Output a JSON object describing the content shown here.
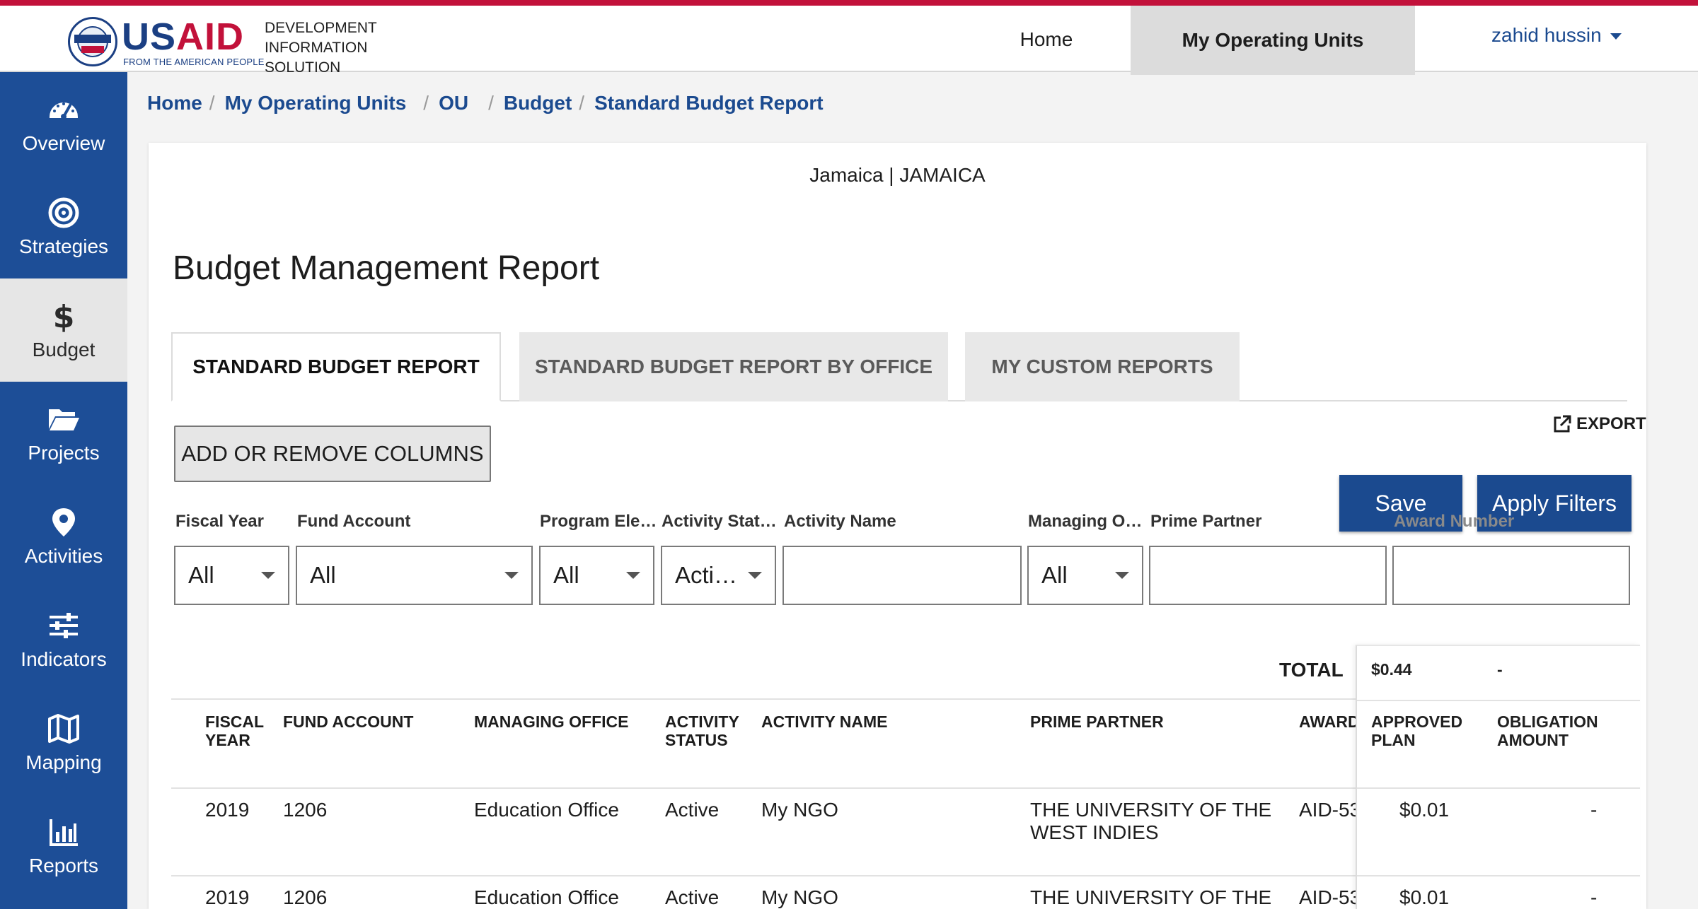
{
  "header": {
    "logo_text_usa": "US",
    "logo_text_aid": "AID",
    "logo_tagline": "FROM THE AMERICAN PEOPLE",
    "app_name_lines": [
      "DEVELOPMENT",
      "INFORMATION",
      "SOLUTION"
    ],
    "nav": {
      "home": "Home",
      "operating_units": "My Operating Units"
    },
    "user_name": "zahid hussin"
  },
  "sidebar": {
    "items": [
      {
        "label": "Overview",
        "icon": "dashboard-icon"
      },
      {
        "label": "Strategies",
        "icon": "target-icon"
      },
      {
        "label": "Budget",
        "icon": "dollar-icon",
        "active": true
      },
      {
        "label": "Projects",
        "icon": "folder-icon"
      },
      {
        "label": "Activities",
        "icon": "map-pin-icon"
      },
      {
        "label": "Indicators",
        "icon": "sliders-icon"
      },
      {
        "label": "Mapping",
        "icon": "map-icon"
      },
      {
        "label": "Reports",
        "icon": "bar-chart-icon"
      }
    ]
  },
  "breadcrumb": [
    "Home",
    "My Operating Units",
    "OU",
    "Budget",
    "Standard Budget Report"
  ],
  "main": {
    "ou_name": "Jamaica | JAMAICA",
    "title": "Budget Management Report",
    "tabs": [
      {
        "label": "STANDARD BUDGET REPORT",
        "active": true
      },
      {
        "label": "STANDARD BUDGET REPORT BY OFFICE",
        "active": false
      },
      {
        "label": "MY CUSTOM REPORTS",
        "active": false
      }
    ],
    "export_label": "EXPORT",
    "columns_button": "ADD OR REMOVE COLUMNS",
    "save_button": "Save",
    "apply_button": "Apply Filters",
    "filters": {
      "fiscal_year": {
        "label": "Fiscal Year",
        "value": "All"
      },
      "fund_account": {
        "label": "Fund Account",
        "value": "All"
      },
      "program_element": {
        "label": "Program Ele…",
        "value": "All"
      },
      "activity_status": {
        "label": "Activity Stat…",
        "value": "Activ…"
      },
      "activity_name": {
        "label": "Activity Name",
        "value": ""
      },
      "managing_office": {
        "label": "Managing O…",
        "value": "All"
      },
      "prime_partner": {
        "label": "Prime Partner",
        "value": ""
      },
      "award_number": {
        "label": "Award Number",
        "value": ""
      }
    }
  },
  "table": {
    "total_label": "TOTAL",
    "total_approved_plan": "$0.44",
    "total_obligation": "-",
    "headers": {
      "fiscal_year": [
        "FISCAL",
        "YEAR"
      ],
      "fund_account": "FUND ACCOUNT",
      "managing_office": "MANAGING OFFICE",
      "activity_status": [
        "ACTIVITY",
        "STATUS"
      ],
      "activity_name": "ACTIVITY NAME",
      "prime_partner": "PRIME PARTNER",
      "award": "AWARD",
      "approved_plan": [
        "APPROVED",
        "PLAN"
      ],
      "obligation": [
        "OBLIGATION",
        "AMOUNT"
      ]
    },
    "rows": [
      {
        "fiscal_year": "2019",
        "fund_account": "1206",
        "managing_office": "Education Office",
        "activity_status": "Active",
        "activity_name": "My NGO",
        "prime_partner_1": "THE UNIVERSITY OF THE",
        "prime_partner_2": "WEST INDIES",
        "award": "AID-53",
        "approved_plan": "$0.01",
        "obligation": "-"
      },
      {
        "fiscal_year": "2019",
        "fund_account": "1206",
        "managing_office": "Education Office",
        "activity_status": "Active",
        "activity_name": "My NGO",
        "prime_partner_1": "THE UNIVERSITY OF THE",
        "prime_partner_2": "",
        "award": "AID-53",
        "approved_plan": "$0.01",
        "obligation": "-"
      }
    ]
  },
  "colors": {
    "brand_blue": "#1b4a8f",
    "sidebar_blue": "#1d4e97",
    "brand_red": "#c2113a"
  }
}
